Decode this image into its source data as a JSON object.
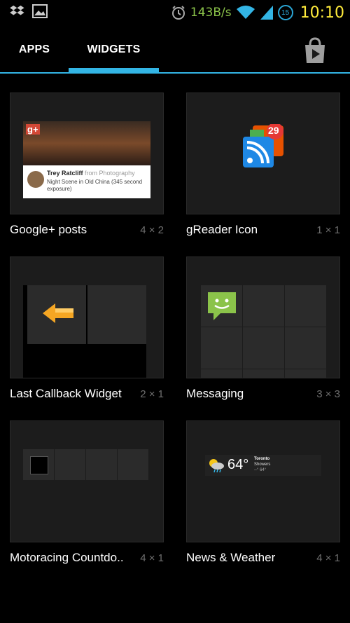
{
  "status_bar": {
    "network_speed": "143B/s",
    "badge": "15",
    "time": "10:10"
  },
  "tabs": [
    {
      "label": "APPS"
    },
    {
      "label": "WIDGETS"
    }
  ],
  "widgets": [
    {
      "name": "Google+ posts",
      "size": "4 × 2",
      "preview": {
        "author": "Trey Ratcliff",
        "from": "from Photography",
        "text": "Night Scene in Old China  (345 second exposure)"
      }
    },
    {
      "name": "gReader Icon",
      "size": "1 × 1",
      "preview": {
        "badge": "29"
      }
    },
    {
      "name": "Last Callback Widget",
      "size": "2 × 1"
    },
    {
      "name": "Messaging",
      "size": "3 × 3"
    },
    {
      "name": "Motoracing Countdo..",
      "size": "4 × 1"
    },
    {
      "name": "News & Weather",
      "size": "4 × 1",
      "preview": {
        "temp": "64°",
        "city": "Toronto",
        "condition": "Showers",
        "range": "--° 64°"
      }
    }
  ],
  "colors": {
    "accent": "#33b5e5",
    "clock": "#ffeb3b",
    "network": "#8bc34a"
  }
}
